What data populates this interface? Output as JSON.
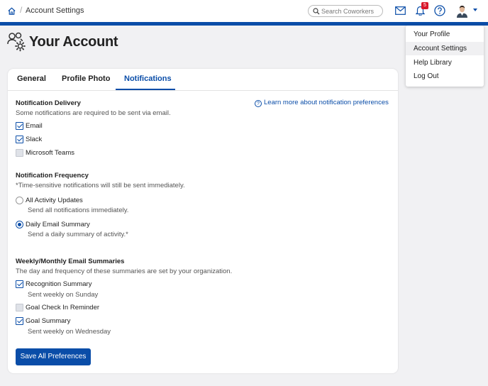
{
  "header": {
    "breadcrumb_current": "Account Settings",
    "breadcrumb_separator": "/",
    "search_placeholder": "Search Coworkers",
    "notification_count": "5"
  },
  "page": {
    "title": "Your Account"
  },
  "tabs": [
    {
      "label": "General",
      "active": false
    },
    {
      "label": "Profile Photo",
      "active": false
    },
    {
      "label": "Notifications",
      "active": true
    }
  ],
  "delivery": {
    "title": "Notification Delivery",
    "subtitle": "Some notifications are required to be sent via email.",
    "learn_more": "Learn more about notification preferences",
    "options": [
      {
        "label": "Email",
        "checked": true,
        "disabled": false
      },
      {
        "label": "Slack",
        "checked": true,
        "disabled": false
      },
      {
        "label": "Microsoft Teams",
        "checked": false,
        "disabled": true
      }
    ]
  },
  "frequency": {
    "title": "Notification Frequency",
    "subtitle": "*Time-sensitive notifications will still be sent immediately.",
    "options": [
      {
        "label": "All Activity Updates",
        "description": "Send all notifications immediately.",
        "selected": false
      },
      {
        "label": "Daily Email Summary",
        "description": "Send a daily summary of activity.*",
        "selected": true
      }
    ]
  },
  "summaries": {
    "title": "Weekly/Monthly Email Summaries",
    "subtitle": "The day and frequency of these summaries are set by your organization.",
    "options": [
      {
        "label": "Recognition Summary",
        "description": "Sent weekly on Sunday",
        "checked": true,
        "disabled": false
      },
      {
        "label": "Goal Check In Reminder",
        "description": "",
        "checked": false,
        "disabled": true
      },
      {
        "label": "Goal Summary",
        "description": "Sent weekly on Wednesday",
        "checked": true,
        "disabled": false
      }
    ]
  },
  "save_button": "Save All Preferences",
  "user_menu": {
    "items": [
      {
        "label": "Your Profile",
        "active": false
      },
      {
        "label": "Account Settings",
        "active": true
      },
      {
        "label": "Help Library",
        "active": false
      },
      {
        "label": "Log Out",
        "active": false
      }
    ]
  },
  "colors": {
    "accent": "#0a4da8",
    "badge": "#d9182b",
    "background": "#f1f1f3"
  },
  "icons": [
    "home-icon",
    "search-icon",
    "mail-icon",
    "bell-icon",
    "help-icon",
    "avatar",
    "account-settings-icon",
    "question-circle-icon"
  ]
}
